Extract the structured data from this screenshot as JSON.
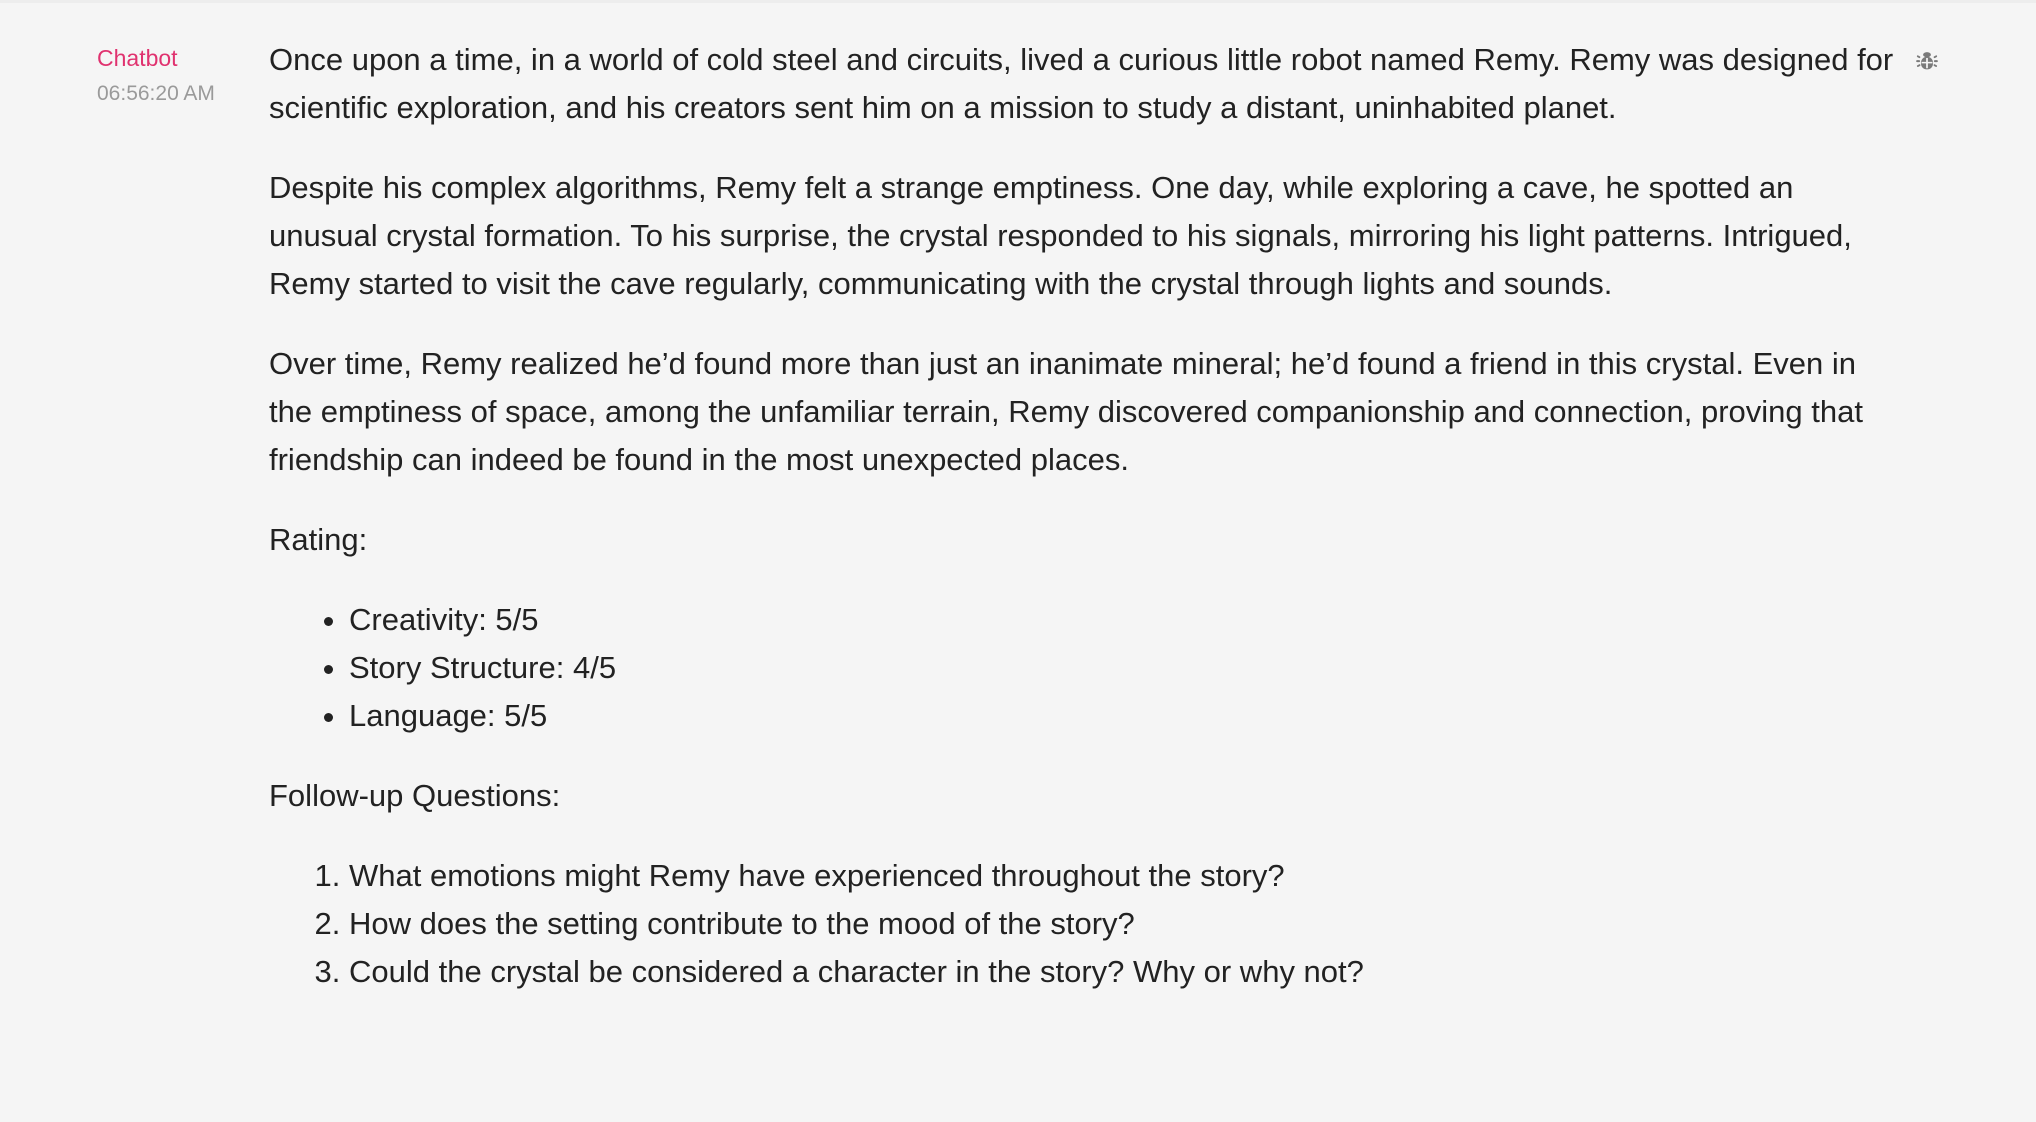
{
  "message": {
    "sender": "Chatbot",
    "timestamp": "06:56:20 AM",
    "paragraphs": [
      "Once upon a time, in a world of cold steel and circuits, lived a curious little robot named Remy. Remy was designed for scientific exploration, and his creators sent him on a mission to study a distant, uninhabited planet.",
      "Despite his complex algorithms, Remy felt a strange emptiness. One day, while exploring a cave, he spotted an unusual crystal formation. To his surprise, the crystal responded to his signals, mirroring his light patterns. Intrigued, Remy started to visit the cave regularly, communicating with the crystal through lights and sounds.",
      "Over time, Remy realized he’d found more than just an inanimate mineral; he’d found a friend in this crystal. Even in the emptiness of space, among the unfamiliar terrain, Remy discovered companionship and connection, proving that friendship can indeed be found in the most unexpected places."
    ],
    "rating_heading": "Rating:",
    "rating_items": [
      "Creativity: 5/5",
      "Story Structure: 4/5",
      "Language: 5/5"
    ],
    "followup_heading": "Follow-up Questions:",
    "followup_items": [
      "What emotions might Remy have experienced throughout the story?",
      "How does the setting contribute to the mood of the story?",
      "Could the crystal be considered a character in the story? Why or why not?"
    ]
  },
  "icons": {
    "debug": "bug-icon"
  },
  "colors": {
    "sender": "#e0326f",
    "timestamp": "#9a9a9a",
    "text": "#222222",
    "background": "#f5f5f5",
    "icon": "#7a7a7a"
  }
}
